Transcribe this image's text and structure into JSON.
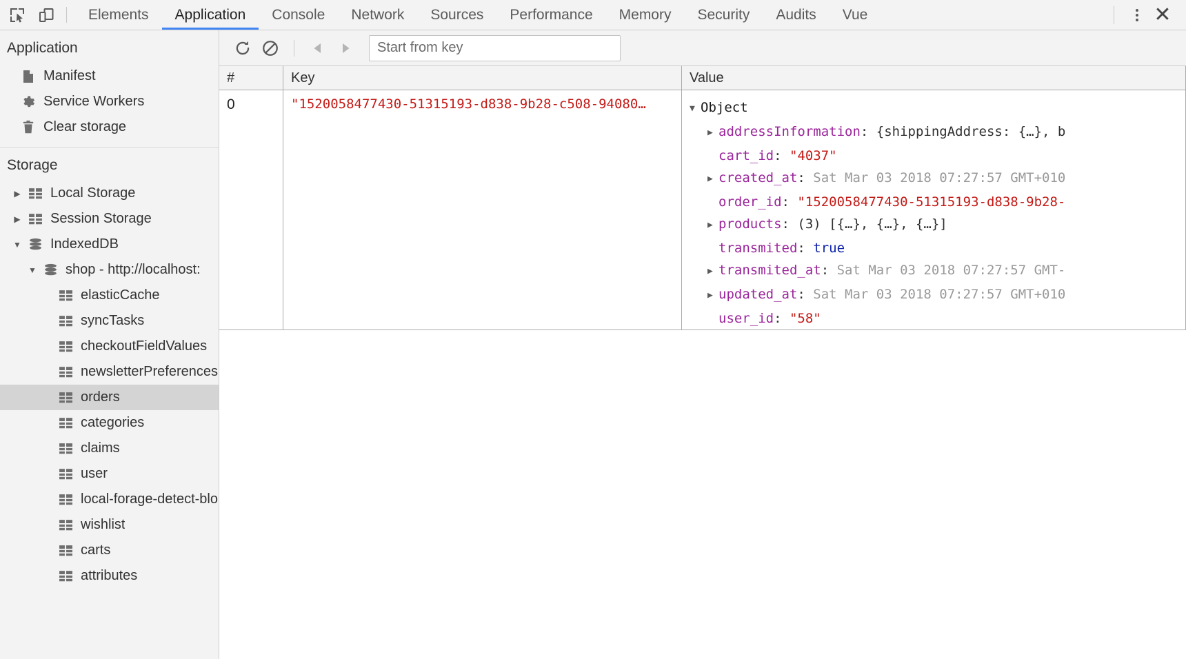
{
  "colors": {
    "accent": "#4285f4",
    "string": "#c41a16",
    "property": "#9b259b",
    "boolean": "#0d22aa",
    "muted": "#999999",
    "selected_row_bg": "#d4d4d4",
    "toolbar_bg": "#f3f3f3"
  },
  "toolbar": {
    "inspect_icon": "inspect-element-icon",
    "device_icon": "toggle-device-toolbar-icon",
    "more_icon": "kebab-menu-icon",
    "close_icon": "close-icon",
    "close_glyph": "✕",
    "tabs": [
      {
        "label": "Elements",
        "selected": false
      },
      {
        "label": "Application",
        "selected": true
      },
      {
        "label": "Console",
        "selected": false
      },
      {
        "label": "Network",
        "selected": false
      },
      {
        "label": "Sources",
        "selected": false
      },
      {
        "label": "Performance",
        "selected": false
      },
      {
        "label": "Memory",
        "selected": false
      },
      {
        "label": "Security",
        "selected": false
      },
      {
        "label": "Audits",
        "selected": false
      },
      {
        "label": "Vue",
        "selected": false
      }
    ]
  },
  "sidebar": {
    "application": {
      "title": "Application",
      "items": [
        {
          "label": "Manifest",
          "icon": "manifest-document-icon"
        },
        {
          "label": "Service Workers",
          "icon": "gear-icon"
        },
        {
          "label": "Clear storage",
          "icon": "trash-icon"
        }
      ]
    },
    "storage": {
      "title": "Storage",
      "items": [
        {
          "label": "Local Storage",
          "icon": "table-icon",
          "arrow": "▶",
          "level": 1,
          "selected": false
        },
        {
          "label": "Session Storage",
          "icon": "table-icon",
          "arrow": "▶",
          "level": 1,
          "selected": false
        },
        {
          "label": "IndexedDB",
          "icon": "database-icon",
          "arrow": "▼",
          "level": 1,
          "selected": false
        },
        {
          "label": "shop - http://localhost:",
          "icon": "database-icon",
          "arrow": "▼",
          "level": 2,
          "selected": false
        },
        {
          "label": "elasticCache",
          "icon": "table-icon",
          "arrow": "",
          "level": 3,
          "selected": false
        },
        {
          "label": "syncTasks",
          "icon": "table-icon",
          "arrow": "",
          "level": 3,
          "selected": false
        },
        {
          "label": "checkoutFieldValues",
          "icon": "table-icon",
          "arrow": "",
          "level": 3,
          "selected": false
        },
        {
          "label": "newsletterPreferences",
          "icon": "table-icon",
          "arrow": "",
          "level": 3,
          "selected": false
        },
        {
          "label": "orders",
          "icon": "table-icon",
          "arrow": "",
          "level": 3,
          "selected": true
        },
        {
          "label": "categories",
          "icon": "table-icon",
          "arrow": "",
          "level": 3,
          "selected": false
        },
        {
          "label": "claims",
          "icon": "table-icon",
          "arrow": "",
          "level": 3,
          "selected": false
        },
        {
          "label": "user",
          "icon": "table-icon",
          "arrow": "",
          "level": 3,
          "selected": false
        },
        {
          "label": "local-forage-detect-blob-support",
          "icon": "table-icon",
          "arrow": "",
          "level": 3,
          "selected": false
        },
        {
          "label": "wishlist",
          "icon": "table-icon",
          "arrow": "",
          "level": 3,
          "selected": false
        },
        {
          "label": "carts",
          "icon": "table-icon",
          "arrow": "",
          "level": 3,
          "selected": false
        },
        {
          "label": "attributes",
          "icon": "table-icon",
          "arrow": "",
          "level": 3,
          "selected": false
        }
      ]
    }
  },
  "storage_toolbar": {
    "refresh_icon": "refresh-icon",
    "clear_icon": "clear-object-store-icon",
    "prev_icon": "previous-page-icon",
    "next_icon": "next-page-icon",
    "prev_glyph": "◀",
    "next_glyph": "▶",
    "start_from_key_placeholder": "Start from key",
    "start_from_key_value": ""
  },
  "grid": {
    "columns": {
      "index": "#",
      "key": "Key",
      "value": "Value"
    },
    "row": {
      "index": "0",
      "key": "\"1520058477430-51315193-d838-9b28-c508-94080…",
      "value_root": "Object",
      "value_root_arrow": "▼",
      "properties": [
        {
          "arrow": "▶",
          "name": "addressInformation",
          "sep": ": ",
          "value": "{shippingAddress: {…}, b",
          "kind": "plain"
        },
        {
          "arrow": "",
          "name": "cart_id",
          "sep": ": ",
          "value": "\"4037\"",
          "kind": "string"
        },
        {
          "arrow": "▶",
          "name": "created_at",
          "sep": ": ",
          "value": "Sat Mar 03 2018 07:27:57 GMT+010",
          "kind": "muted"
        },
        {
          "arrow": "",
          "name": "order_id",
          "sep": ": ",
          "value": "\"1520058477430-51315193-d838-9b28-",
          "kind": "string"
        },
        {
          "arrow": "▶",
          "name": "products",
          "sep": ": ",
          "value": "(3) [{…}, {…}, {…}]",
          "kind": "array"
        },
        {
          "arrow": "",
          "name": "transmited",
          "sep": ": ",
          "value": "true",
          "kind": "boolean"
        },
        {
          "arrow": "▶",
          "name": "transmited_at",
          "sep": ": ",
          "value": "Sat Mar 03 2018 07:27:57 GMT-",
          "kind": "muted"
        },
        {
          "arrow": "▶",
          "name": "updated_at",
          "sep": ": ",
          "value": "Sat Mar 03 2018 07:27:57 GMT+010",
          "kind": "muted"
        },
        {
          "arrow": "",
          "name": "user_id",
          "sep": ": ",
          "value": "\"58\"",
          "kind": "string"
        }
      ]
    }
  }
}
